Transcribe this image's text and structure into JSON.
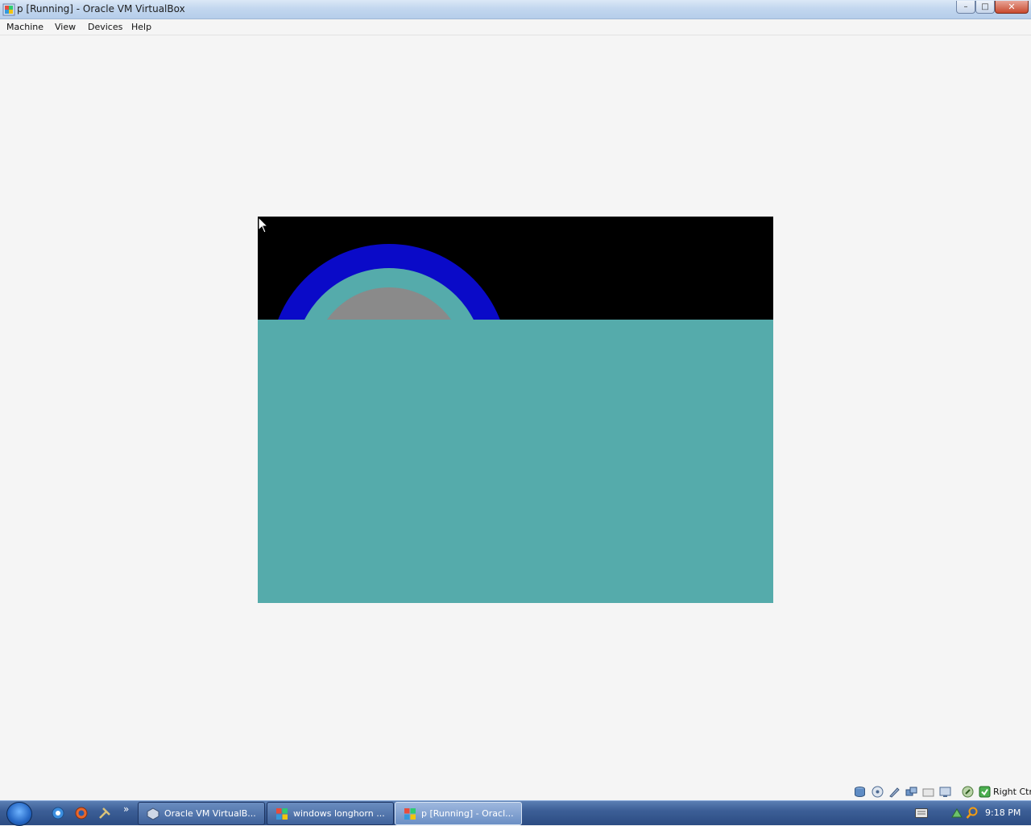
{
  "window": {
    "title": "p [Running] - Oracle VM VirtualBox",
    "controls": {
      "minimize": "–",
      "maximize": "□",
      "close": "✕"
    }
  },
  "menu": {
    "items": [
      "Machine",
      "View",
      "Devices",
      "Help"
    ]
  },
  "vm_display": {
    "background_top": "#000000",
    "background_bottom": "#55abab",
    "ring_outer_color": "#0a0ac8",
    "ring_inner_color": "#55abab",
    "core_color": "#8a8a8a"
  },
  "statusbar": {
    "icons": [
      "hard-disk-icon",
      "optical-drive-icon",
      "usb-icon",
      "network-icon",
      "shared-folder-icon",
      "display-icon",
      "mouse-integration-icon",
      "keyboard-capture-icon"
    ],
    "host_key": "Right Ctrl"
  },
  "taskbar": {
    "quick_launch": [
      "chrome-icon",
      "firefox-icon",
      "tool-icon"
    ],
    "overflow": "»",
    "tasks": [
      {
        "label": "Oracle VM VirtualB...",
        "active": false
      },
      {
        "label": "windows longhorn ...",
        "active": false
      },
      {
        "label": "p [Running] - Oracl...",
        "active": true
      }
    ],
    "clock": "9:18 PM"
  }
}
